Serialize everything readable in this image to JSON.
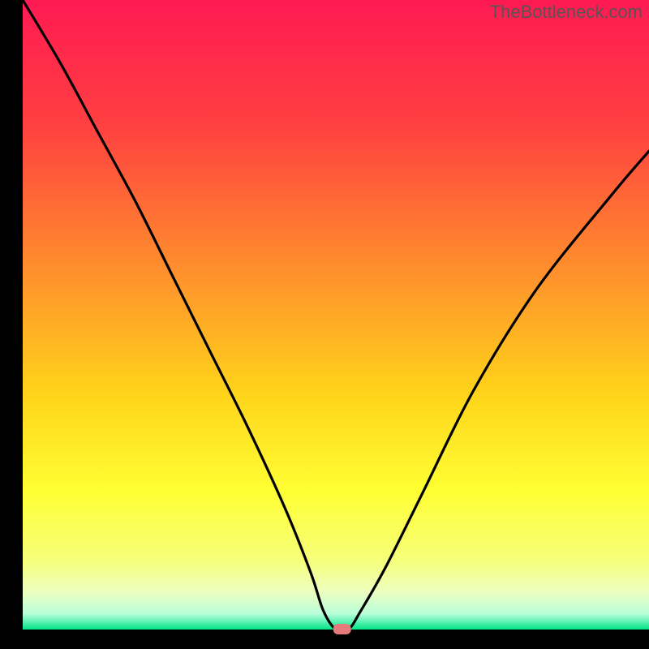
{
  "watermark": "TheBottleneck.com",
  "chart_data": {
    "type": "line",
    "title": "",
    "xlabel": "",
    "ylabel": "",
    "xlim": [
      0,
      100
    ],
    "ylim": [
      0,
      100
    ],
    "series": [
      {
        "name": "bottleneck-curve",
        "x": [
          0,
          6,
          12,
          18,
          24,
          30,
          36,
          42,
          46,
          48,
          50,
          52,
          54,
          58,
          64,
          72,
          82,
          94,
          100
        ],
        "values": [
          100,
          90,
          79,
          68,
          56,
          44,
          32,
          19,
          9,
          3,
          0,
          0,
          3,
          10,
          22,
          38,
          54,
          69,
          76
        ]
      }
    ],
    "marker": {
      "x": 51,
      "y": 0
    },
    "gradient_stops": [
      {
        "offset": 0.0,
        "color": "#ff1a53"
      },
      {
        "offset": 0.2,
        "color": "#ff4040"
      },
      {
        "offset": 0.42,
        "color": "#ff8c2e"
      },
      {
        "offset": 0.62,
        "color": "#ffd21a"
      },
      {
        "offset": 0.78,
        "color": "#ffff33"
      },
      {
        "offset": 0.89,
        "color": "#f6ff7a"
      },
      {
        "offset": 0.94,
        "color": "#ecffc0"
      },
      {
        "offset": 0.975,
        "color": "#b9ffda"
      },
      {
        "offset": 1.0,
        "color": "#00e588"
      }
    ],
    "frame": {
      "left_margin_frac": 0.035,
      "bottom_margin_frac": 0.03
    }
  }
}
